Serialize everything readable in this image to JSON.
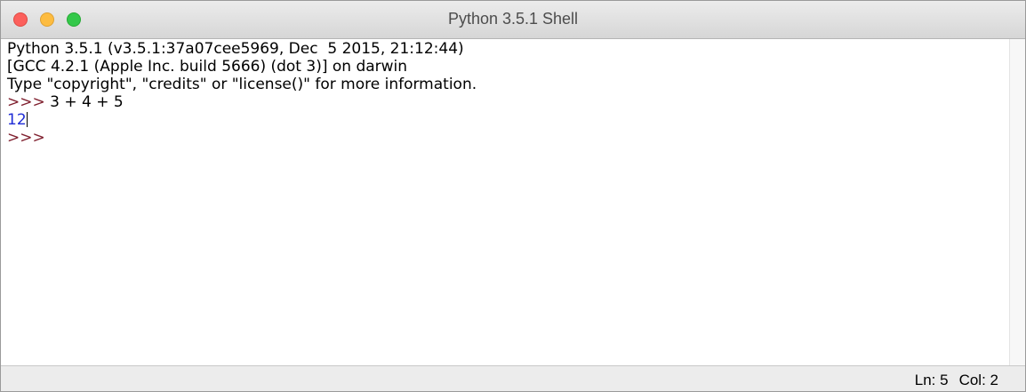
{
  "window": {
    "title": "Python 3.5.1 Shell"
  },
  "shell": {
    "banner": [
      "Python 3.5.1 (v3.5.1:37a07cee5969, Dec  5 2015, 21:12:44)",
      "[GCC 4.2.1 (Apple Inc. build 5666) (dot 3)] on darwin",
      "Type \"copyright\", \"credits\" or \"license()\" for more information."
    ],
    "prompt": ">>> ",
    "command": "3 + 4 + 5",
    "output": "12"
  },
  "status": {
    "line": "Ln: 5",
    "column": "Col: 2"
  },
  "colors": {
    "prompt": "#7f1f2e",
    "output": "#1f2cd6"
  }
}
